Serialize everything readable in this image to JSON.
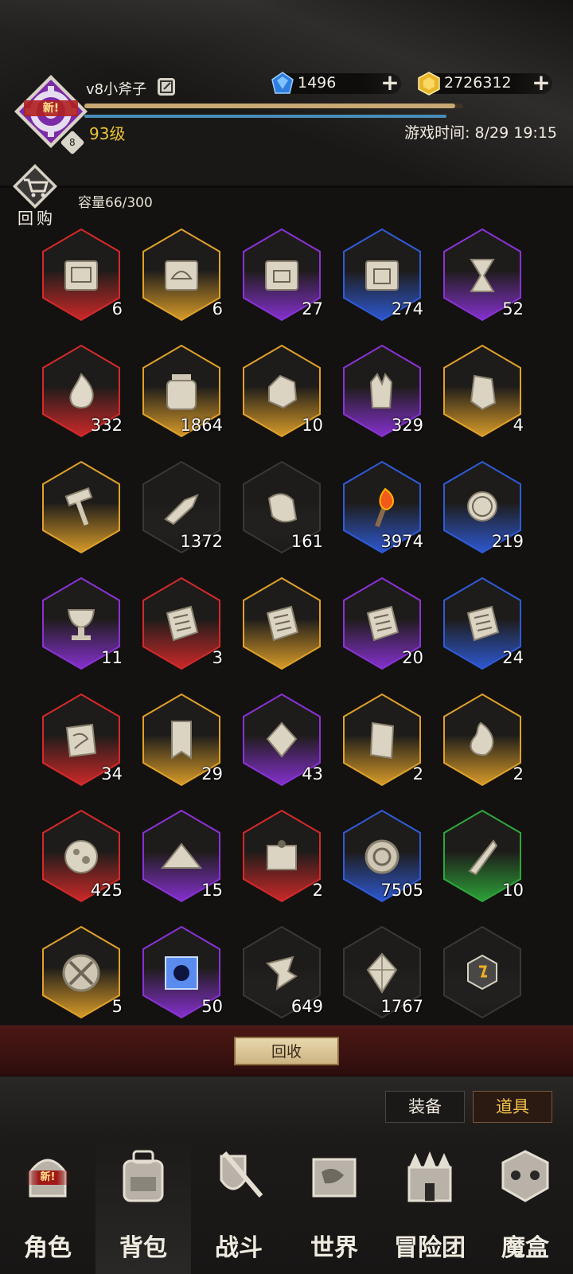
{
  "header": {
    "player_name": "v8小斧子",
    "level": "93级",
    "avatar_badge": "新!",
    "avatar_rank": "8",
    "xp_fraction": 0.98,
    "game_time": "游戏时间: 8/29 19:15",
    "gems": "1496",
    "gold": "2726312"
  },
  "bag": {
    "recycle_shop_label": "回购",
    "capacity": "容量66/300",
    "items": [
      {
        "name": "map-scroll",
        "qty": "6",
        "rarity": "red"
      },
      {
        "name": "treasure-map",
        "qty": "6",
        "rarity": "orange"
      },
      {
        "name": "chest-map",
        "qty": "27",
        "rarity": "purple"
      },
      {
        "name": "box-map",
        "qty": "274",
        "rarity": "blue"
      },
      {
        "name": "hourglass",
        "qty": "52",
        "rarity": "purple"
      },
      {
        "name": "flame",
        "qty": "332",
        "rarity": "red"
      },
      {
        "name": "jar",
        "qty": "1864",
        "rarity": "orange"
      },
      {
        "name": "ore",
        "qty": "10",
        "rarity": "orange"
      },
      {
        "name": "crystal",
        "qty": "329",
        "rarity": "purple"
      },
      {
        "name": "rune-stone",
        "qty": "4",
        "rarity": "orange"
      },
      {
        "name": "hammer",
        "qty": "",
        "rarity": "orange"
      },
      {
        "name": "feather-scroll",
        "qty": "1372",
        "rarity": "gray"
      },
      {
        "name": "cloth",
        "qty": "161",
        "rarity": "gray"
      },
      {
        "name": "torch",
        "qty": "3974",
        "rarity": "blue"
      },
      {
        "name": "compass",
        "qty": "219",
        "rarity": "blue"
      },
      {
        "name": "chalice",
        "qty": "11",
        "rarity": "purple"
      },
      {
        "name": "tablet",
        "qty": "3",
        "rarity": "red"
      },
      {
        "name": "tablet",
        "qty": "",
        "rarity": "orange"
      },
      {
        "name": "tablet",
        "qty": "20",
        "rarity": "purple"
      },
      {
        "name": "tablet",
        "qty": "24",
        "rarity": "blue"
      },
      {
        "name": "marked-stone",
        "qty": "34",
        "rarity": "red"
      },
      {
        "name": "bookmark",
        "qty": "29",
        "rarity": "orange"
      },
      {
        "name": "gem-stone",
        "qty": "43",
        "rarity": "purple"
      },
      {
        "name": "slab",
        "qty": "2",
        "rarity": "orange"
      },
      {
        "name": "spirit-flame",
        "qty": "2",
        "rarity": "orange"
      },
      {
        "name": "moon-ball",
        "qty": "425",
        "rarity": "red"
      },
      {
        "name": "sand-pile",
        "qty": "15",
        "rarity": "purple"
      },
      {
        "name": "spiked-scroll",
        "qty": "2",
        "rarity": "red"
      },
      {
        "name": "orb-relic",
        "qty": "7505",
        "rarity": "blue"
      },
      {
        "name": "blade-shard",
        "qty": "10",
        "rarity": "green"
      },
      {
        "name": "sword-medal",
        "qty": "5",
        "rarity": "orange"
      },
      {
        "name": "blue-cube",
        "qty": "50",
        "rarity": "purple"
      },
      {
        "name": "paper-shard",
        "qty": "649",
        "rarity": "gray"
      },
      {
        "name": "diamond-shard",
        "qty": "1767",
        "rarity": "gray"
      },
      {
        "name": "rune-hex",
        "qty": "",
        "rarity": "gray"
      }
    ]
  },
  "actions": {
    "recycle": "回收",
    "tab_equip": "装备",
    "tab_items": "道具"
  },
  "nav": [
    {
      "label": "角色",
      "icon": "helmet-icon",
      "badge": "新!"
    },
    {
      "label": "背包",
      "icon": "backpack-icon"
    },
    {
      "label": "战斗",
      "icon": "shield-sword-icon"
    },
    {
      "label": "世界",
      "icon": "world-map-icon"
    },
    {
      "label": "冒险团",
      "icon": "castle-icon"
    },
    {
      "label": "魔盒",
      "icon": "magic-box-icon"
    }
  ],
  "colors": {
    "red": "#d42a2a",
    "orange": "#e0a12a",
    "purple": "#8a32d6",
    "blue": "#2f5bd8",
    "green": "#2ea83a",
    "gray": "#3a3836",
    "level": "#e9c43a"
  }
}
